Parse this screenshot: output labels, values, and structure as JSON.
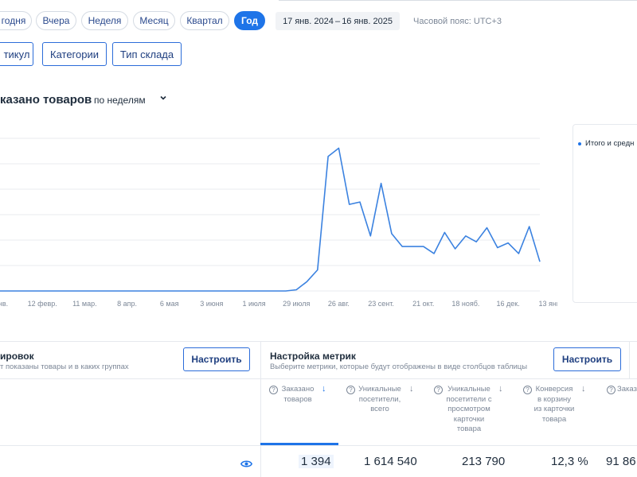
{
  "periods": {
    "today": "годня",
    "yesterday": "Вчера",
    "week": "Неделя",
    "month": "Месяц",
    "quarter": "Квартал",
    "year": "Год"
  },
  "date_range": {
    "start": "17 янв. 2024",
    "dash": "–",
    "end": "16 янв. 2025"
  },
  "timezone": "Часовой пояс: UTC+3",
  "filters": {
    "article": "тикул",
    "categories": "Категории",
    "warehouse_type": "Тип склада"
  },
  "chart_header": {
    "title": "казано товаров",
    "period_select": "по неделям"
  },
  "legend": {
    "item": "Итого и средн"
  },
  "colors": {
    "accent": "#1e74e8",
    "line": "#3b82e0",
    "border": "#2b6cd9"
  },
  "chart_data": {
    "type": "line",
    "title": "",
    "x_tick_labels": [
      "нв.",
      "12 февр.",
      "11 мар.",
      "8 апр.",
      "6 мая",
      "3 июня",
      "1 июля",
      "29 июля",
      "26 авг.",
      "23 сент.",
      "21 окт.",
      "18 нояб.",
      "16 дек.",
      "13 янв."
    ],
    "series": [
      {
        "values": [
          0,
          0,
          0,
          0,
          0,
          0,
          0,
          0,
          0,
          0,
          0,
          0,
          0,
          0,
          0,
          0,
          0,
          0,
          0,
          0,
          0,
          0,
          0,
          0,
          0,
          0,
          0,
          0,
          1,
          8,
          18,
          115,
          122,
          74,
          76,
          47,
          92,
          49,
          38,
          38,
          38,
          32,
          50,
          36,
          47,
          42,
          54,
          37,
          41,
          32,
          55,
          25
        ]
      }
    ],
    "grid": true,
    "legend_position": "right"
  },
  "grouping_panel": {
    "title": "ировок",
    "subtitle": "т показаны товары и в каких группах",
    "button": "Настроить"
  },
  "metrics_panel": {
    "title": "Настройка метрик",
    "subtitle": "Выберите метрики, которые будут отображены в виде столбцов таблицы",
    "button": "Настроить"
  },
  "columns": [
    {
      "header": "Заказано товаров",
      "value": "1 394"
    },
    {
      "header": "Уникальные посетители, всего",
      "value": "1 614 540"
    },
    {
      "header": "Уникальные посетители с просмотром карточки товара",
      "value": "213 790"
    },
    {
      "header": "Конверсия в корзину из карточки товара",
      "value": "12,3 %"
    },
    {
      "header": "Заказ",
      "value": "91 86"
    }
  ],
  "help_glyph": "?",
  "sort_glyph": "↓"
}
